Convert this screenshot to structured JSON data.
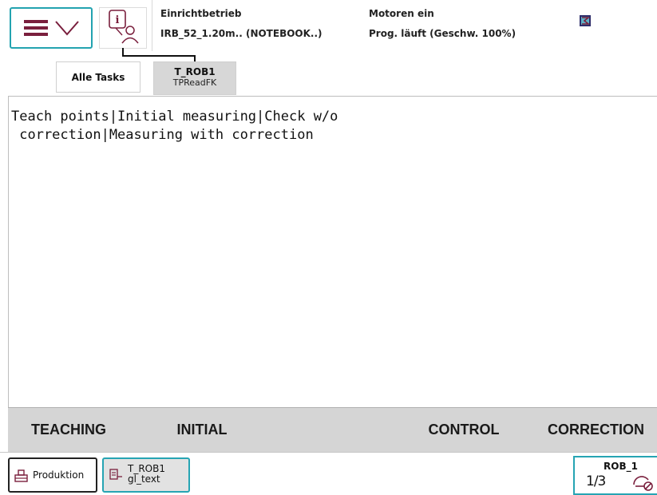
{
  "status": {
    "mode": "Einrichtbetrieb",
    "controller": "IRB_52_1.20m.. (NOTEBOOK..)",
    "motors": "Motoren ein",
    "program": "Prog. läuft (Geschw. 100%)"
  },
  "tabs": [
    {
      "label": "Alle Tasks"
    },
    {
      "label": "T_ROB1",
      "sublabel": "TPReadFK"
    }
  ],
  "message": {
    "line1": "Teach points|Initial measuring|Check w/o",
    "line2": " correction|Measuring with correction"
  },
  "function_keys": [
    "TEACHING",
    "INITIAL",
    "",
    "CONTROL",
    "CORRECTION"
  ],
  "taskbar": {
    "production": "Produktion",
    "task_name": "T_ROB1",
    "task_sub": "gl_text",
    "robot": "ROB_1",
    "increment": "1/3"
  },
  "colors": {
    "accent": "#26a4b3",
    "icon": "#7a1f3d",
    "fkey_bar": "#d5d5d5"
  },
  "icons": [
    "hamburger-menu-icon",
    "chevron-down-icon",
    "info-user-icon",
    "status-small-icon",
    "production-icon",
    "task-icon",
    "increment-icon",
    "jog-icon"
  ]
}
